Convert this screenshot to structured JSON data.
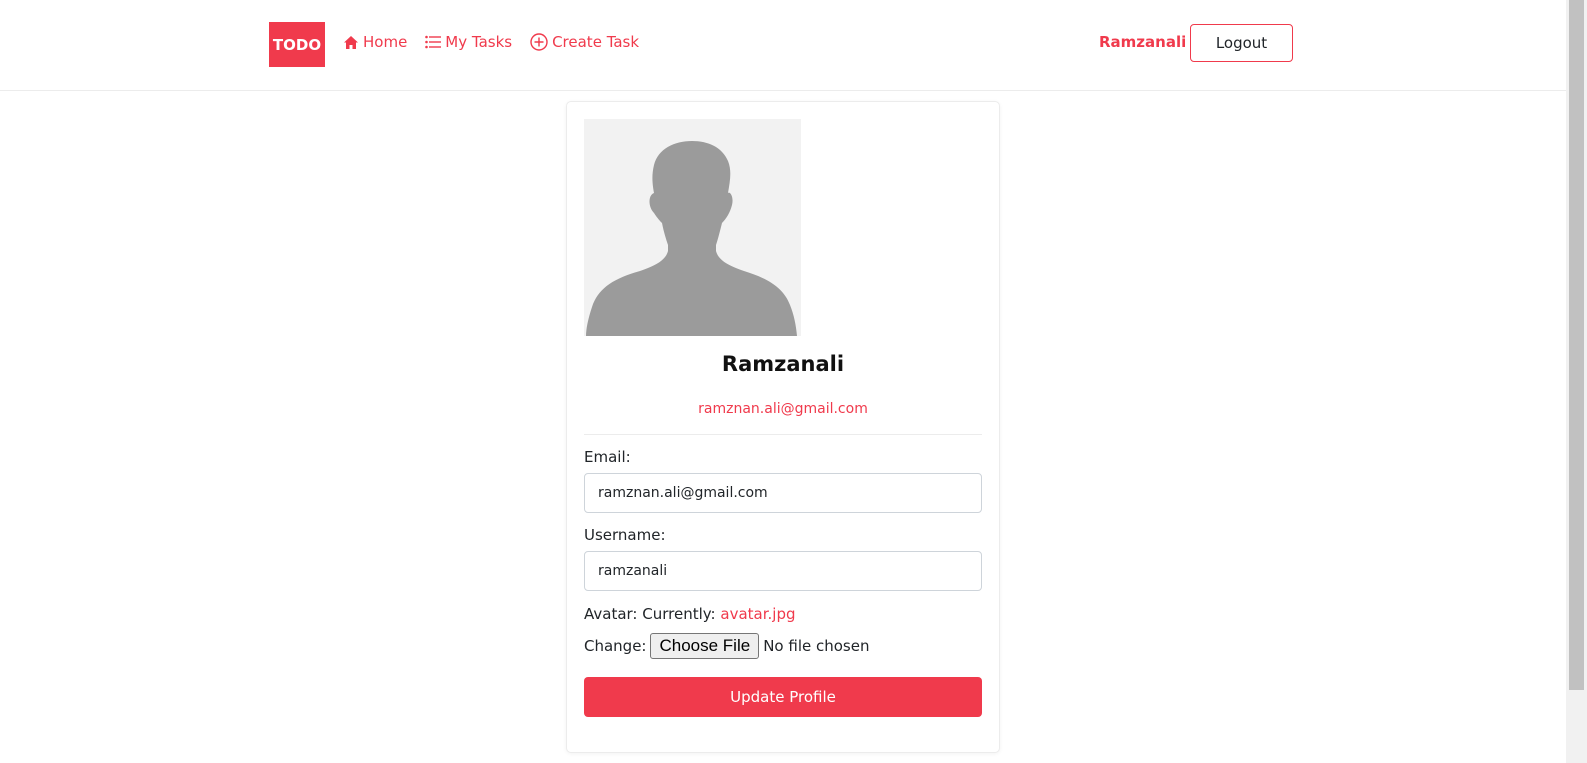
{
  "colors": {
    "accent": "#f03a4c",
    "text": "#212529",
    "border": "#ced4da"
  },
  "navbar": {
    "brand": "TODO",
    "links": [
      {
        "label": "Home",
        "icon": "home-icon"
      },
      {
        "label": "My Tasks",
        "icon": "list-icon"
      },
      {
        "label": "Create Task",
        "icon": "plus-circle-icon"
      }
    ],
    "username": "Ramzanali",
    "logout_label": "Logout"
  },
  "profile": {
    "avatar_icon": "avatar-silhouette-icon",
    "name": "Ramzanali",
    "email": "ramznan.ali@gmail.com"
  },
  "form": {
    "email_label": "Email:",
    "email_value": "ramznan.ali@gmail.com",
    "username_label": "Username:",
    "username_value": "ramzanali",
    "avatar_label": "Avatar: Currently:",
    "avatar_file": "avatar.jpg",
    "change_label": "Change:",
    "choose_file_label": "Choose File",
    "no_file_text": "No file chosen",
    "submit_label": "Update Profile"
  }
}
